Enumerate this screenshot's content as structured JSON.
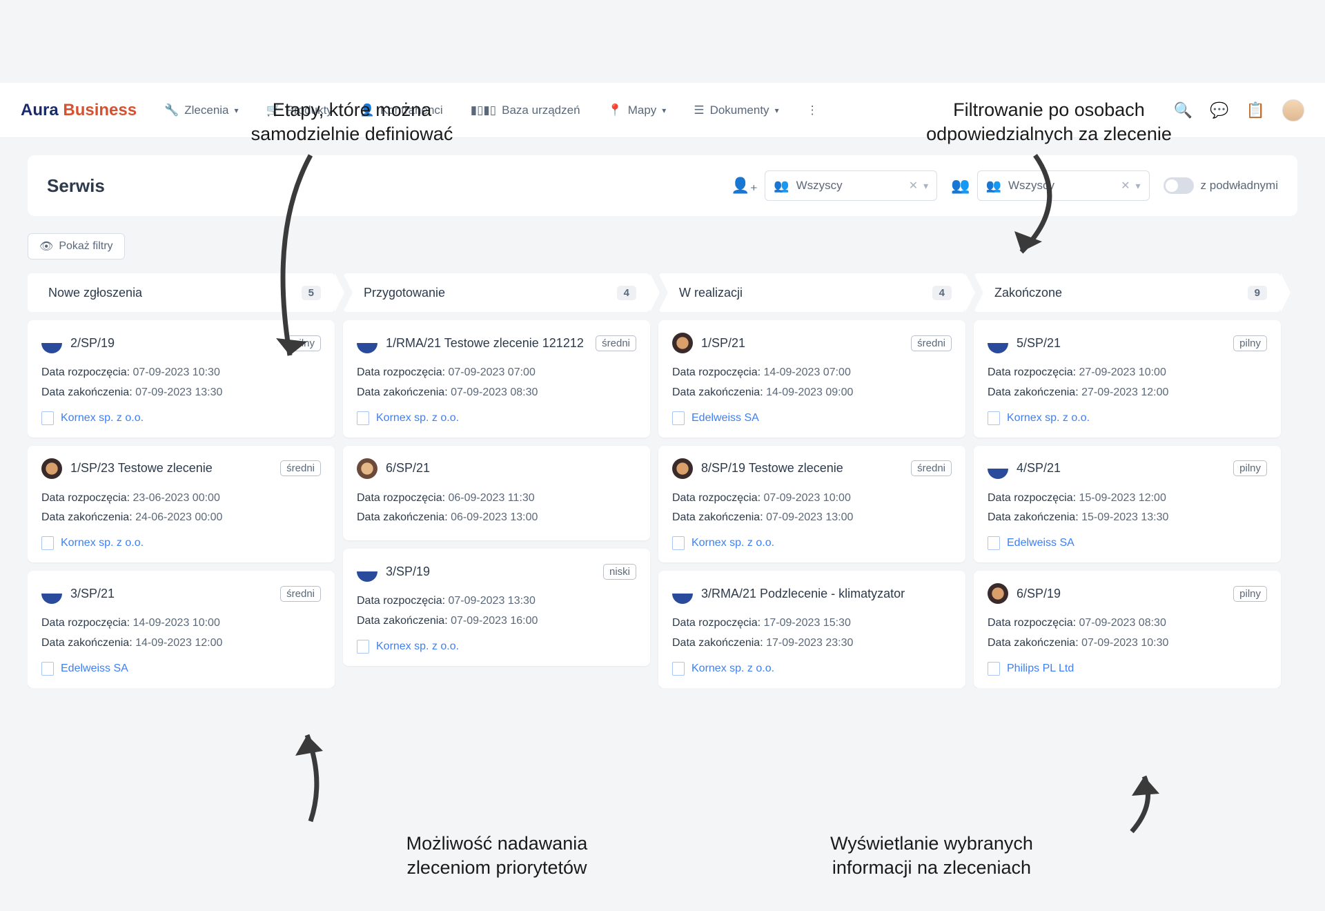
{
  "annotations": {
    "top_left": "Etapy, które można\nsamodzielnie definiować",
    "top_right": "Filtrowanie po osobach\nodpowiedzialnych za zlecenie",
    "bottom_left": "Możliwość nadawania\nzleceniom priorytetów",
    "bottom_right": "Wyświetlanie wybranych\ninformacji na zleceniach"
  },
  "logo": {
    "part1": "Aura ",
    "part2": "Business"
  },
  "nav": {
    "zlecenia": "Zlecenia",
    "produkty": "Produkty",
    "kontrahenci": "Kontrahenci",
    "baza": "Baza urządzeń",
    "mapy": "Mapy",
    "dokumenty": "Dokumenty"
  },
  "panel": {
    "title": "Serwis",
    "filter1": "Wszyscy",
    "filter2": "Wszyscy",
    "toggle_label": "z podwładnymi"
  },
  "show_filters": "Pokaż filtry",
  "labels": {
    "start": "Data rozpoczęcia:",
    "end": "Data zakończenia:"
  },
  "columns": [
    {
      "title": "Nowe zgłoszenia",
      "count": "5",
      "cards": [
        {
          "av": "av1",
          "title": "2/SP/19",
          "prio": "pilny",
          "start": "07-09-2023 10:30",
          "end": "07-09-2023 13:30",
          "company": "Kornex sp. z o.o."
        },
        {
          "av": "av2",
          "title": "1/SP/23 Testowe zlecenie",
          "prio": "średni",
          "start": "23-06-2023 00:00",
          "end": "24-06-2023 00:00",
          "company": "Kornex sp. z o.o."
        },
        {
          "av": "av1",
          "title": "3/SP/21",
          "prio": "średni",
          "start": "14-09-2023 10:00",
          "end": "14-09-2023 12:00",
          "company": "Edelweiss SA"
        }
      ]
    },
    {
      "title": "Przygotowanie",
      "count": "4",
      "cards": [
        {
          "av": "av1",
          "title": "1/RMA/21 Testowe zlecenie 121212",
          "prio": "średni",
          "start": "07-09-2023 07:00",
          "end": "07-09-2023 08:30",
          "company": "Kornex sp. z o.o."
        },
        {
          "av": "av3",
          "title": "6/SP/21",
          "prio": "",
          "start": "06-09-2023 11:30",
          "end": "06-09-2023 13:00",
          "company": ""
        },
        {
          "av": "av1",
          "title": "3/SP/19",
          "prio": "niski",
          "start": "07-09-2023 13:30",
          "end": "07-09-2023 16:00",
          "company": "Kornex sp. z o.o."
        }
      ]
    },
    {
      "title": "W realizacji",
      "count": "4",
      "cards": [
        {
          "av": "av2",
          "title": "1/SP/21",
          "prio": "średni",
          "start": "14-09-2023 07:00",
          "end": "14-09-2023 09:00",
          "company": "Edelweiss SA"
        },
        {
          "av": "av2",
          "title": "8/SP/19 Testowe zlecenie",
          "prio": "średni",
          "start": "07-09-2023 10:00",
          "end": "07-09-2023 13:00",
          "company": "Kornex sp. z o.o."
        },
        {
          "av": "av1",
          "title": "3/RMA/21 Podzlecenie - klimatyzator",
          "prio": "",
          "start": "17-09-2023 15:30",
          "end": "17-09-2023 23:30",
          "company": "Kornex sp. z o.o."
        }
      ]
    },
    {
      "title": "Zakończone",
      "count": "9",
      "cards": [
        {
          "av": "av1",
          "title": "5/SP/21",
          "prio": "pilny",
          "start": "27-09-2023 10:00",
          "end": "27-09-2023 12:00",
          "company": "Kornex sp. z o.o."
        },
        {
          "av": "av1",
          "title": "4/SP/21",
          "prio": "pilny",
          "start": "15-09-2023 12:00",
          "end": "15-09-2023 13:30",
          "company": "Edelweiss SA"
        },
        {
          "av": "av2",
          "title": "6/SP/19",
          "prio": "pilny",
          "start": "07-09-2023 08:30",
          "end": "07-09-2023 10:30",
          "company": "Philips PL Ltd"
        }
      ]
    }
  ]
}
